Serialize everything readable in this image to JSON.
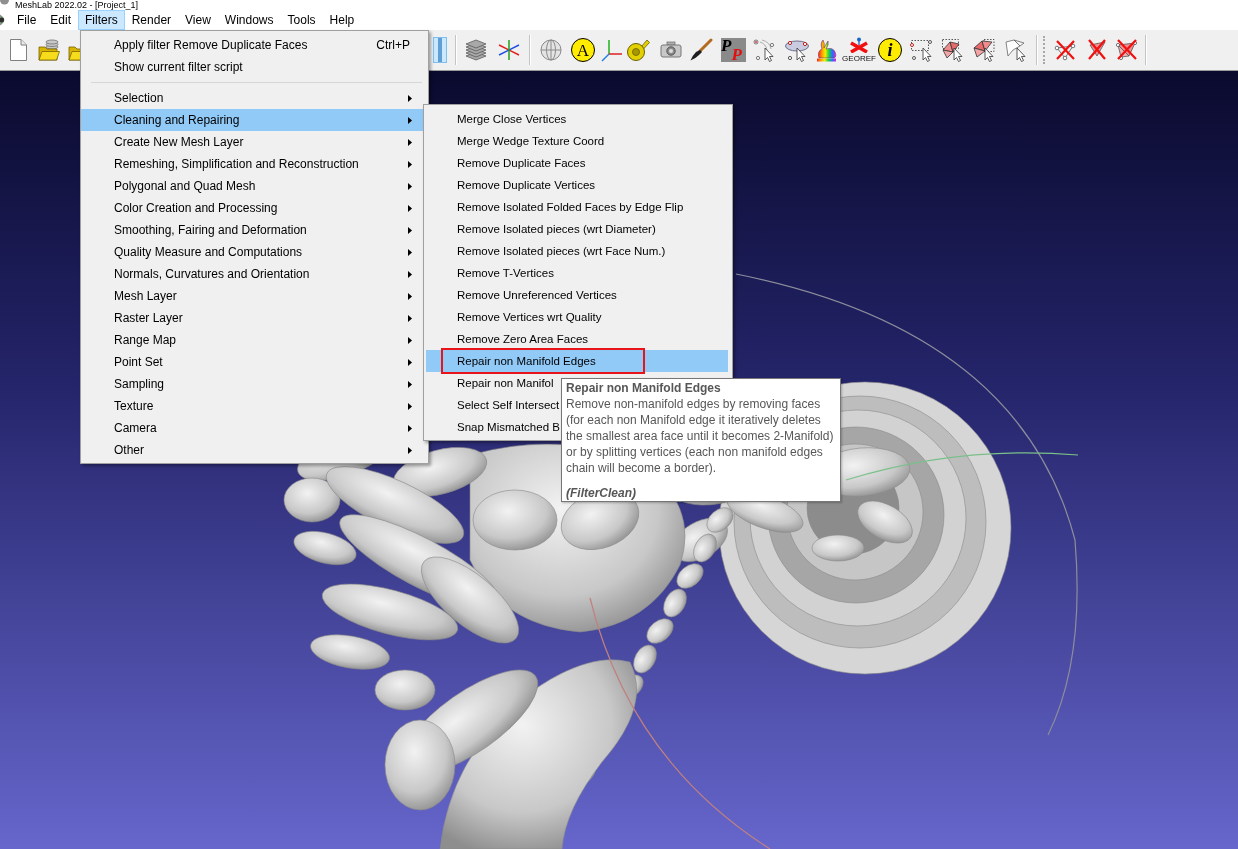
{
  "window": {
    "title": "MeshLab 2022.02 - [Project_1]"
  },
  "menu_bar": [
    {
      "label": "File",
      "selected": false
    },
    {
      "label": "Edit",
      "selected": false
    },
    {
      "label": "Filters",
      "selected": true
    },
    {
      "label": "Render",
      "selected": false
    },
    {
      "label": "View",
      "selected": false
    },
    {
      "label": "Windows",
      "selected": false
    },
    {
      "label": "Tools",
      "selected": false
    },
    {
      "label": "Help",
      "selected": false
    }
  ],
  "toolbar": {
    "toggle_button": {
      "checked": true
    },
    "letter_badge": "A",
    "logo_letters": [
      "P",
      "P"
    ],
    "georef_label": "GEOREF",
    "info_letter": "i"
  },
  "filters_menu": {
    "items": [
      {
        "kind": "command",
        "label": "Apply filter Remove Duplicate Faces",
        "shortcut": "Ctrl+P",
        "selected": false
      },
      {
        "kind": "command",
        "label": "Show current filter script",
        "selected": false
      },
      {
        "kind": "separator"
      },
      {
        "kind": "submenu",
        "label": "Selection",
        "selected": false
      },
      {
        "kind": "submenu",
        "label": "Cleaning and Repairing",
        "selected": true
      },
      {
        "kind": "submenu",
        "label": "Create New Mesh Layer",
        "selected": false
      },
      {
        "kind": "submenu",
        "label": "Remeshing, Simplification and Reconstruction",
        "selected": false
      },
      {
        "kind": "submenu",
        "label": "Polygonal and Quad Mesh",
        "selected": false
      },
      {
        "kind": "submenu",
        "label": "Color Creation and Processing",
        "selected": false
      },
      {
        "kind": "submenu",
        "label": "Smoothing, Fairing and Deformation",
        "selected": false
      },
      {
        "kind": "submenu",
        "label": "Quality Measure and Computations",
        "selected": false
      },
      {
        "kind": "submenu",
        "label": "Normals, Curvatures and Orientation",
        "selected": false
      },
      {
        "kind": "submenu",
        "label": "Mesh Layer",
        "selected": false
      },
      {
        "kind": "submenu",
        "label": "Raster Layer",
        "selected": false
      },
      {
        "kind": "submenu",
        "label": "Range Map",
        "selected": false
      },
      {
        "kind": "submenu",
        "label": "Point Set",
        "selected": false
      },
      {
        "kind": "submenu",
        "label": "Sampling",
        "selected": false
      },
      {
        "kind": "submenu",
        "label": "Texture",
        "selected": false
      },
      {
        "kind": "submenu",
        "label": "Camera",
        "selected": false
      },
      {
        "kind": "submenu",
        "label": "Other",
        "selected": false
      }
    ]
  },
  "cleaning_submenu": {
    "items": [
      {
        "label": "Merge Close Vertices",
        "selected": false,
        "annotated": false
      },
      {
        "label": "Merge Wedge Texture Coord",
        "selected": false,
        "annotated": false
      },
      {
        "label": "Remove Duplicate Faces",
        "selected": false,
        "annotated": false
      },
      {
        "label": "Remove Duplicate Vertices",
        "selected": false,
        "annotated": false
      },
      {
        "label": "Remove Isolated Folded Faces by Edge Flip",
        "selected": false,
        "annotated": false
      },
      {
        "label": "Remove Isolated pieces (wrt Diameter)",
        "selected": false,
        "annotated": false
      },
      {
        "label": "Remove Isolated pieces (wrt Face Num.)",
        "selected": false,
        "annotated": false
      },
      {
        "label": "Remove T-Vertices",
        "selected": false,
        "annotated": false
      },
      {
        "label": "Remove Unreferenced Vertices",
        "selected": false,
        "annotated": false
      },
      {
        "label": "Remove Vertices wrt Quality",
        "selected": false,
        "annotated": false
      },
      {
        "label": "Remove Zero Area Faces",
        "selected": false,
        "annotated": false
      },
      {
        "label": "Repair non Manifold Edges",
        "selected": true,
        "annotated": true
      },
      {
        "label": "Repair non Manifol",
        "selected": false,
        "annotated": false
      },
      {
        "label": "Select Self Intersect",
        "selected": false,
        "annotated": false
      },
      {
        "label": "Snap Mismatched B",
        "selected": false,
        "annotated": false
      }
    ]
  },
  "tooltip": {
    "title": "Repair non Manifold Edges",
    "text": "Remove non-manifold edges by removing faces (for each non Manifold edge it iteratively deletes the smallest area face until it becomes 2-Manifold) or by splitting vertices (each non manifold edges chain will become a border).",
    "source": "(FilterClean)"
  }
}
